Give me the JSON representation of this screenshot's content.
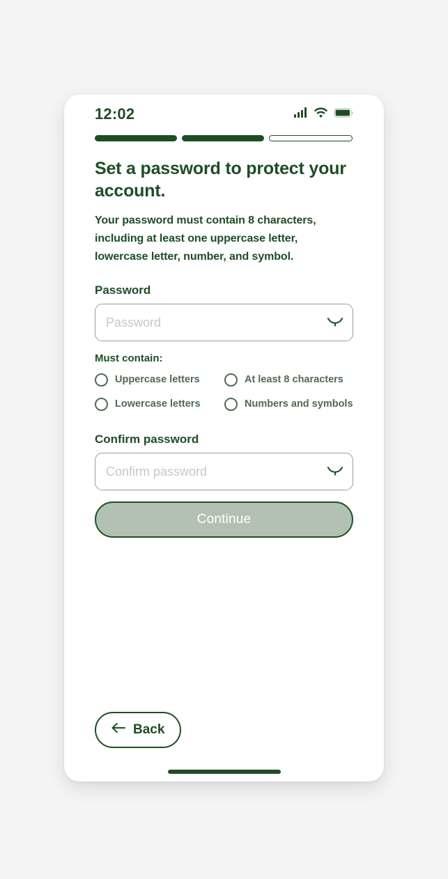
{
  "theme": {
    "page_background": "#f4f4f4",
    "brand_green": "#1e4d25",
    "muted_green": "#4f6b55",
    "placeholder_gray": "#c2cbc2",
    "disabled_button_fill": "#b2c1b2",
    "input_border": "#8fa68f"
  },
  "status_bar": {
    "time": "12:02",
    "signal_icon": "cellular-signal-icon",
    "wifi_icon": "wifi-icon",
    "battery_icon": "battery-full-icon"
  },
  "progress": {
    "total_steps": 3,
    "completed_steps": 2,
    "segments": [
      "filled",
      "filled",
      "empty"
    ]
  },
  "main": {
    "title": "Set a password to protect your account.",
    "description": "Your password must contain 8 characters, including at least one uppercase letter, lowercase letter, number, and symbol.",
    "password": {
      "label": "Password",
      "placeholder": "Password",
      "value": "",
      "toggle_icon": "eye-off-icon"
    },
    "requirements": {
      "label": "Must contain:",
      "items": [
        {
          "text": "Uppercase letters",
          "met": false
        },
        {
          "text": "At least 8 characters",
          "met": false
        },
        {
          "text": "Lowercase letters",
          "met": false
        },
        {
          "text": "Numbers and symbols",
          "met": false
        }
      ]
    },
    "confirm_password": {
      "label": "Confirm password",
      "placeholder": "Confirm password",
      "value": "",
      "toggle_icon": "eye-off-icon"
    },
    "continue_button": {
      "label": "Continue",
      "enabled": false
    }
  },
  "footer": {
    "back_button": {
      "label": "Back",
      "icon": "arrow-left-icon"
    },
    "home_indicator": "home-indicator"
  }
}
